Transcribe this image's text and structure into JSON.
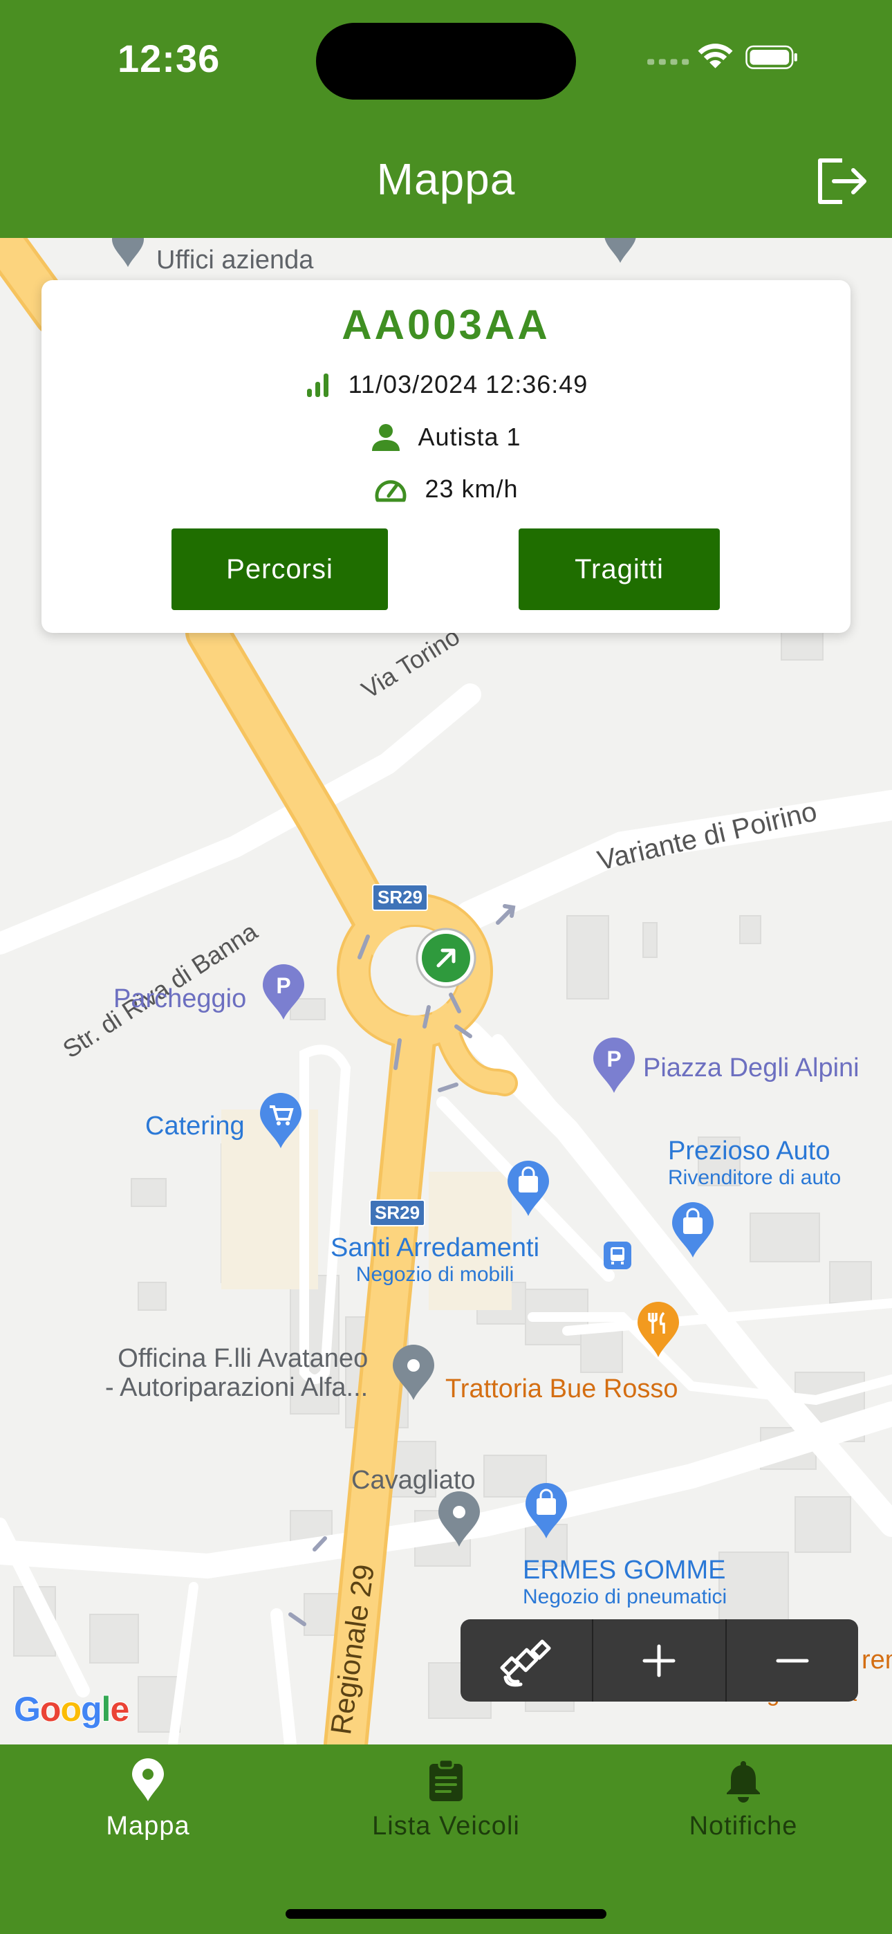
{
  "status_bar": {
    "time": "12:36"
  },
  "header": {
    "title": "Mappa"
  },
  "vehicle_card": {
    "plate": "AA003AA",
    "timestamp": "11/03/2024 12:36:49",
    "driver": "Autista 1",
    "speed": "23 km/h",
    "routes_button": "Percorsi",
    "trips_button": "Tragitti"
  },
  "map": {
    "labels": {
      "uffici": "Uffici azienda",
      "via_torino": "Via Torino",
      "riva_banna": "Str. di Riva di Banna",
      "variante": "Variante di Poirino",
      "sr29_a": "SR29",
      "sr29_b": "SR29",
      "parcheggio": "Parcheggio",
      "piazza": "Piazza Degli Alpini",
      "catering": "Catering",
      "prezioso": "Prezioso Auto",
      "prezioso_sub": "Rivenditore di auto",
      "santi": "Santi Arredamenti",
      "santi_sub": "Negozio di mobili",
      "officina_1": "Officina F.lli Avataneo",
      "officina_2": "- Autoriparazioni Alfa...",
      "trattoria": "Trattoria Bue Rosso",
      "cavagliato": "Cavagliato",
      "ermes": "ERMES GOMME",
      "ermes_sub": "Negozio di pneumatici",
      "regionale": "Regionale 29",
      "edge_orange_1": "rem",
      "edge_orange_2": "cioccolato gelateria"
    },
    "attribution": [
      "G",
      "o",
      "o",
      "g",
      "l",
      "e"
    ]
  },
  "tabs": [
    {
      "label": "Mappa",
      "icon": "map-pin-icon",
      "active": true
    },
    {
      "label": "Lista Veicoli",
      "icon": "clipboard-icon",
      "active": false
    },
    {
      "label": "Notifiche",
      "icon": "bell-icon",
      "active": false
    }
  ],
  "colors": {
    "brand_green": "#4a8f22",
    "button_green": "#1f6e00",
    "plate_green": "#3f8f22",
    "road_yellow": "#fcd47e"
  }
}
